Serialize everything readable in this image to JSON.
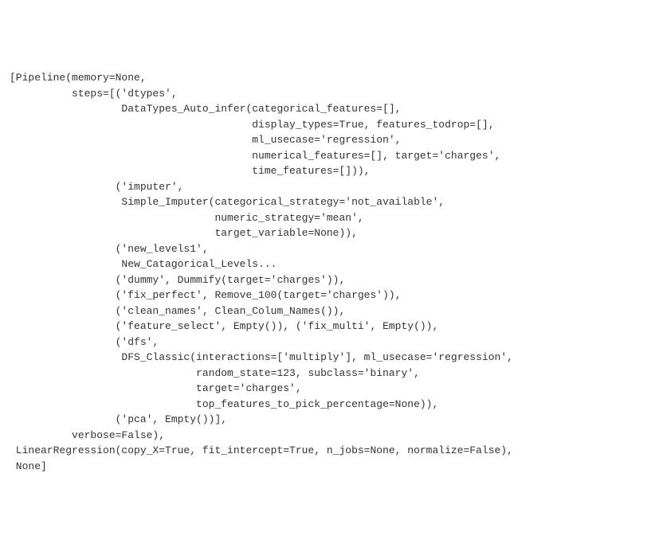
{
  "code_output": {
    "lines": [
      "[Pipeline(memory=None,",
      "          steps=[('dtypes',",
      "                  DataTypes_Auto_infer(categorical_features=[],",
      "                                       display_types=True, features_todrop=[],",
      "                                       ml_usecase='regression',",
      "                                       numerical_features=[], target='charges',",
      "                                       time_features=[])),",
      "                 ('imputer',",
      "                  Simple_Imputer(categorical_strategy='not_available',",
      "                                 numeric_strategy='mean',",
      "                                 target_variable=None)),",
      "                 ('new_levels1',",
      "                  New_Catagorical_Levels...",
      "                 ('dummy', Dummify(target='charges')),",
      "                 ('fix_perfect', Remove_100(target='charges')),",
      "                 ('clean_names', Clean_Colum_Names()),",
      "                 ('feature_select', Empty()), ('fix_multi', Empty()),",
      "                 ('dfs',",
      "                  DFS_Classic(interactions=['multiply'], ml_usecase='regression',",
      "                              random_state=123, subclass='binary',",
      "                              target='charges',",
      "                              top_features_to_pick_percentage=None)),",
      "                 ('pca', Empty())],",
      "          verbose=False),",
      " LinearRegression(copy_X=True, fit_intercept=True, n_jobs=None, normalize=False),",
      " None]"
    ]
  },
  "pipeline_data": {
    "memory": null,
    "verbose": false,
    "steps": [
      {
        "name": "dtypes",
        "class": "DataTypes_Auto_infer",
        "params": {
          "categorical_features": [],
          "display_types": true,
          "features_todrop": [],
          "ml_usecase": "regression",
          "numerical_features": [],
          "target": "charges",
          "time_features": []
        }
      },
      {
        "name": "imputer",
        "class": "Simple_Imputer",
        "params": {
          "categorical_strategy": "not_available",
          "numeric_strategy": "mean",
          "target_variable": null
        }
      },
      {
        "name": "new_levels1",
        "class": "New_Catagorical_Levels",
        "truncated": true
      },
      {
        "name": "dummy",
        "class": "Dummify",
        "params": {
          "target": "charges"
        }
      },
      {
        "name": "fix_perfect",
        "class": "Remove_100",
        "params": {
          "target": "charges"
        }
      },
      {
        "name": "clean_names",
        "class": "Clean_Colum_Names",
        "params": {}
      },
      {
        "name": "feature_select",
        "class": "Empty",
        "params": {}
      },
      {
        "name": "fix_multi",
        "class": "Empty",
        "params": {}
      },
      {
        "name": "dfs",
        "class": "DFS_Classic",
        "params": {
          "interactions": [
            "multiply"
          ],
          "ml_usecase": "regression",
          "random_state": 123,
          "subclass": "binary",
          "target": "charges",
          "top_features_to_pick_percentage": null
        }
      },
      {
        "name": "pca",
        "class": "Empty",
        "params": {}
      }
    ],
    "model": {
      "class": "LinearRegression",
      "params": {
        "copy_X": true,
        "fit_intercept": true,
        "n_jobs": null,
        "normalize": false
      }
    },
    "third_element": null
  }
}
